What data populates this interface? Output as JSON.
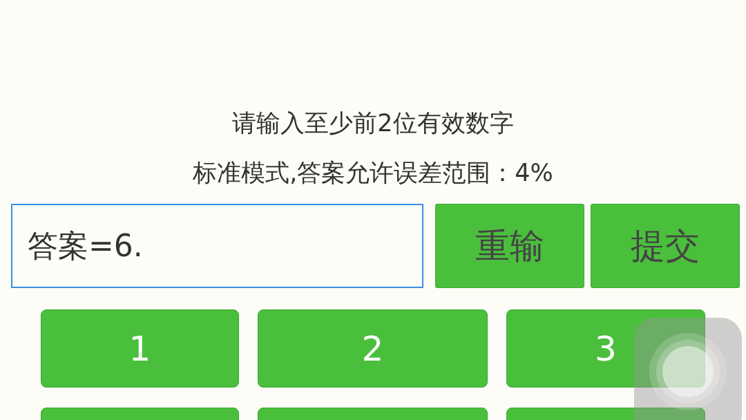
{
  "hints": [
    "请输入至少前2位有效数字",
    "标准模式,答案允许误差范围：4%"
  ],
  "answer_field": {
    "value": "答案=6."
  },
  "action_buttons": [
    "重输",
    "提交"
  ],
  "keypad": [
    "1",
    "2",
    "3"
  ]
}
